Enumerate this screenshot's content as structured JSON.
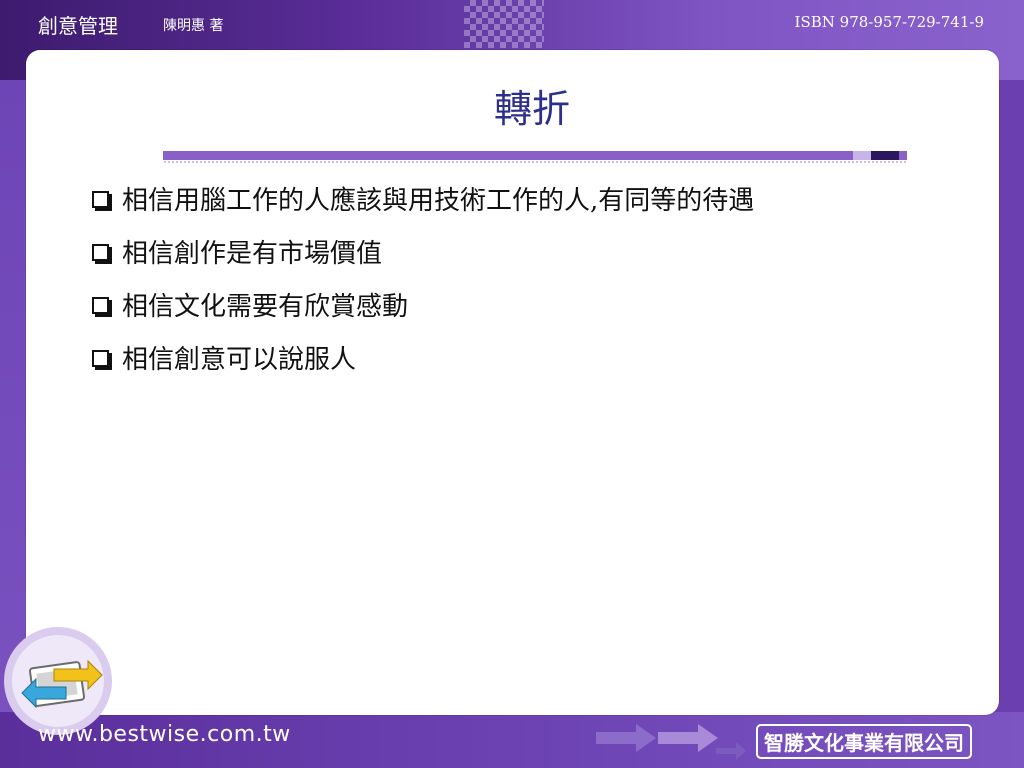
{
  "header": {
    "book_title": "創意管理",
    "author": "陳明惠 著",
    "isbn": "ISBN 978-957-729-741-9"
  },
  "slide": {
    "title": "轉折",
    "bullets": [
      "相信用腦工作的人應該與用技術工作的人,有同等的待遇",
      "相信創作是有市場價值",
      "相信文化需要有欣賞感動",
      "相信創意可以說服人"
    ]
  },
  "footer": {
    "url": "www.bestwise.com.tw",
    "publisher": "智勝文化事業有限公司"
  },
  "icons": {
    "nav": "back-forward-arrows-icon",
    "footer_arrows": "arrow-right-icon"
  },
  "colors": {
    "title": "#2d2f8c",
    "background_purple": "#6b3fb0",
    "accent_bar": "#8860c8"
  }
}
